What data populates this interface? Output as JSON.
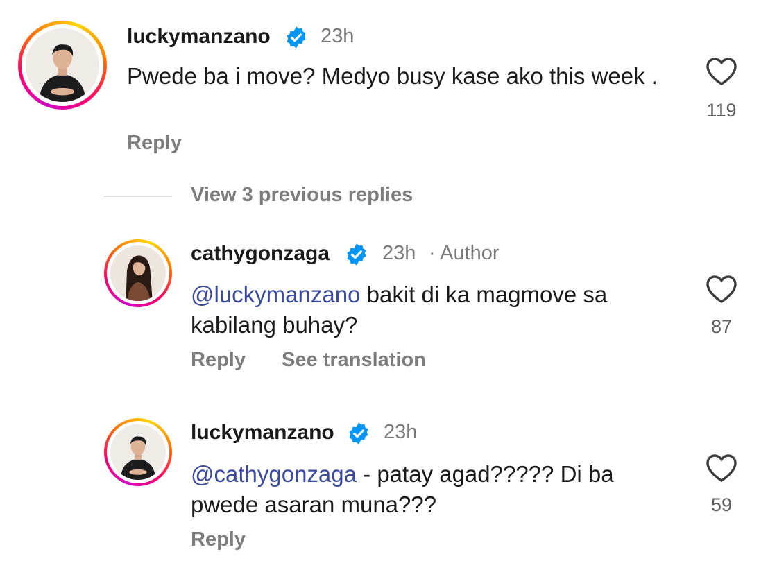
{
  "colors": {
    "mention": "#3a4a9e",
    "verified": "#0095f6",
    "muted": "#7a7a7a"
  },
  "comments": [
    {
      "username": "luckymanzano",
      "time": "23h",
      "text": "Pwede ba i move? Medyo busy kase ako this week .",
      "likes": "119",
      "reply_label": "Reply",
      "avatar_icon": "man-portrait-avatar"
    },
    {
      "username": "cathygonzaga",
      "time": "23h",
      "author_label": "· Author",
      "mention": "@luckymanzano",
      "text": " bakit di ka magmove sa kabilang buhay?",
      "likes": "87",
      "reply_label": "Reply",
      "translate_label": "See translation",
      "avatar_icon": "woman-portrait-avatar"
    },
    {
      "username": "luckymanzano",
      "time": "23h",
      "mention": "@cathygonzaga",
      "text": " - patay agad????? Di ba pwede asaran muna???",
      "likes": "59",
      "reply_label": "Reply",
      "avatar_icon": "man-portrait-avatar"
    }
  ],
  "view_previous_label": "View 3 previous replies"
}
